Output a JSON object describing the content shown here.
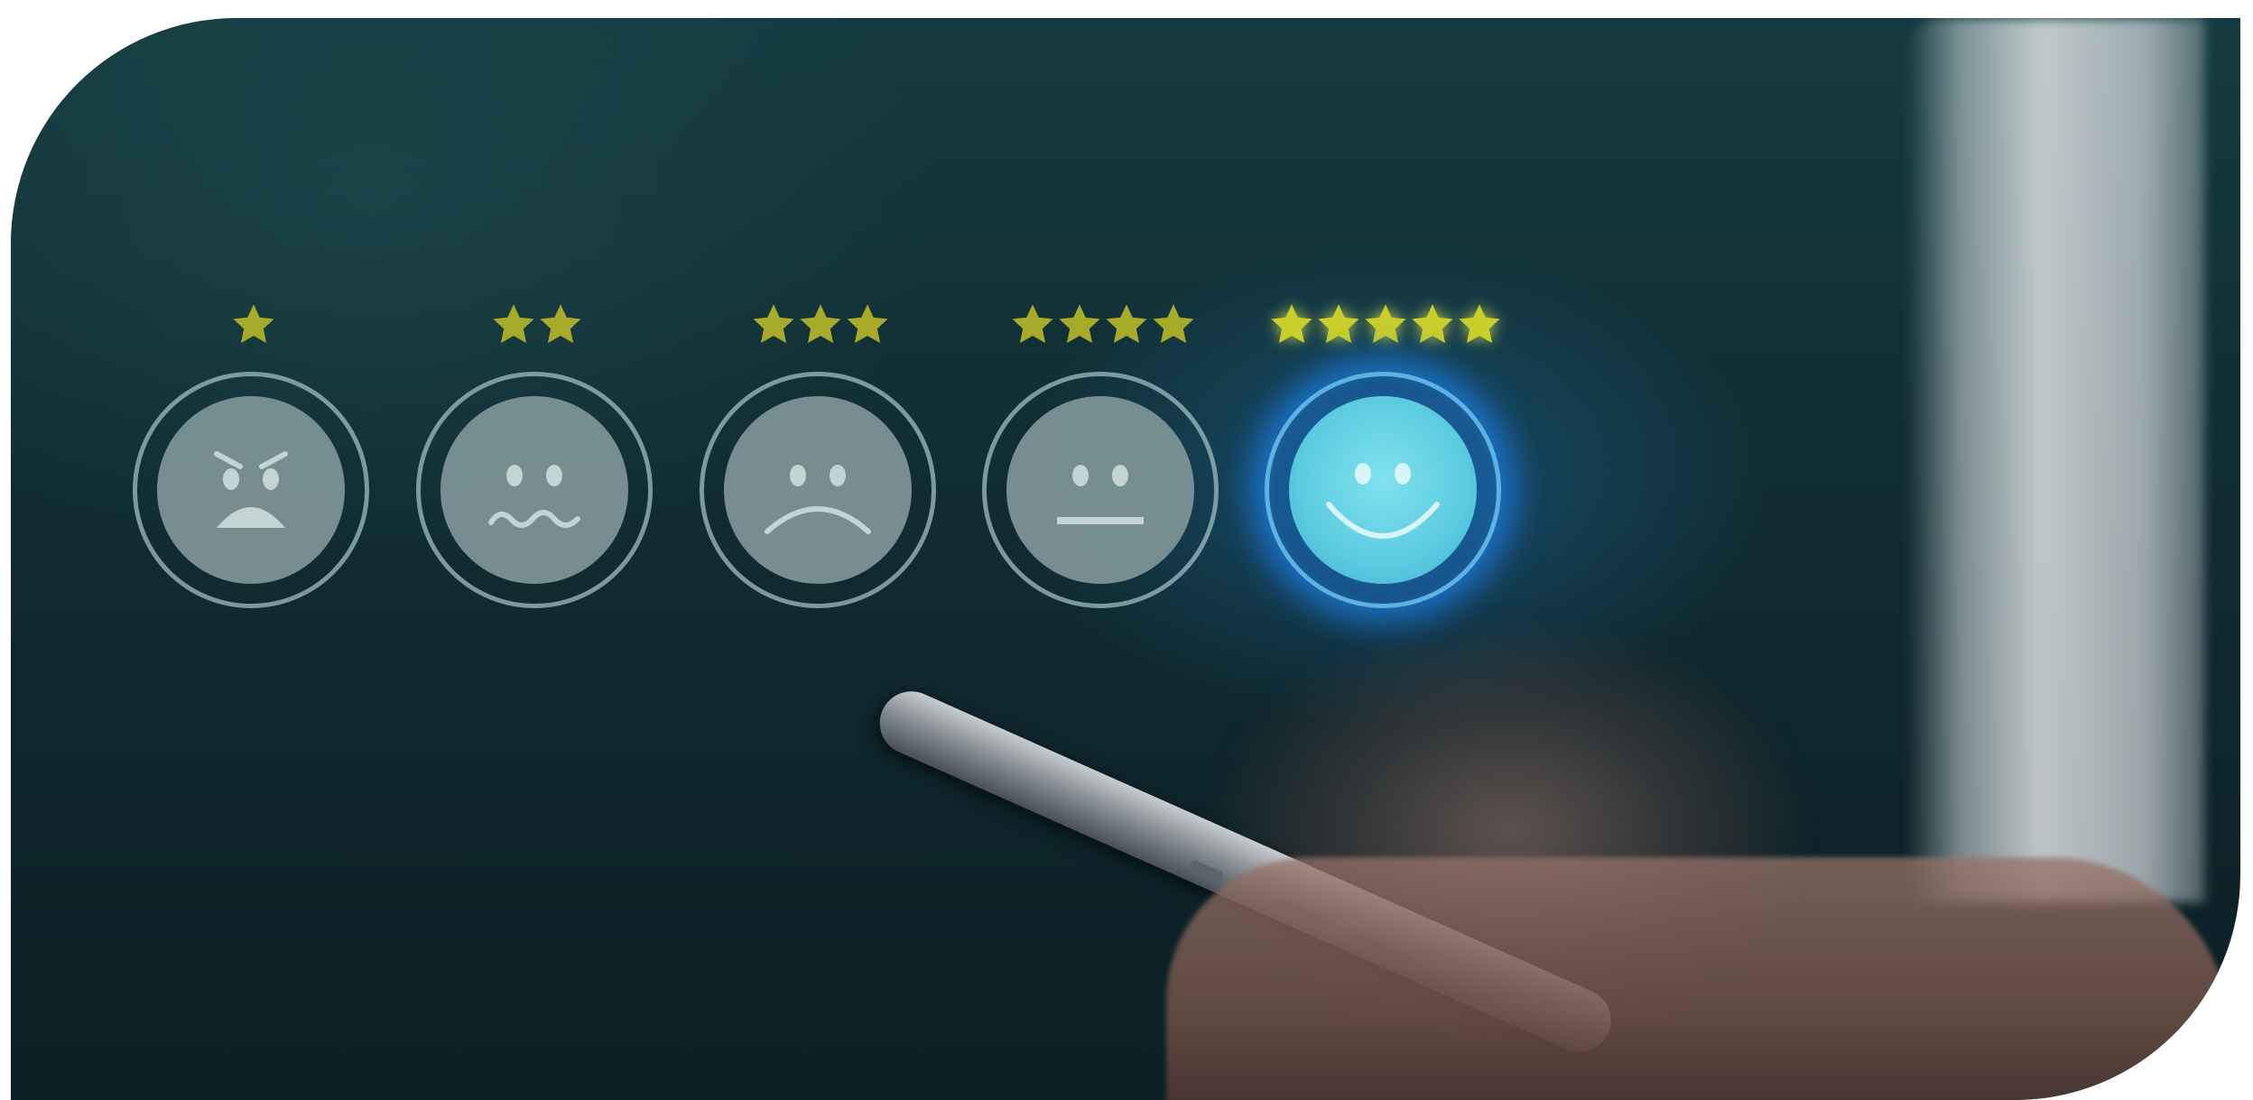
{
  "scene": {
    "description_tags": [
      "customer-satisfaction",
      "rating",
      "smartphone"
    ]
  },
  "rating": {
    "selected_stars": 5,
    "options": [
      {
        "stars": 1,
        "face": "angry-face-icon"
      },
      {
        "stars": 2,
        "face": "worried-face-icon"
      },
      {
        "stars": 3,
        "face": "sad-face-icon"
      },
      {
        "stars": 4,
        "face": "neutral-face-icon"
      },
      {
        "stars": 5,
        "face": "happy-face-icon"
      }
    ]
  },
  "colors": {
    "background": "#112f35",
    "star_fill": "#a8ab2a",
    "star_selected": "#c9cf2a",
    "face_fill": "#8096a0",
    "face_selected": "#5ccbe0",
    "glow": "#1e82e6"
  }
}
